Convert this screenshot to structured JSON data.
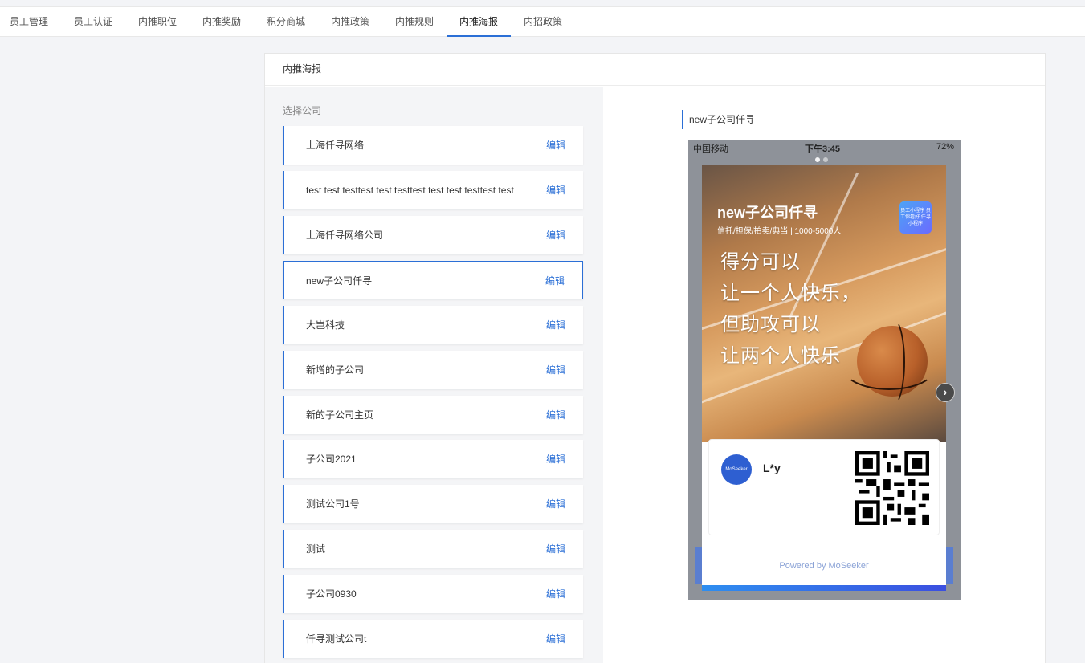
{
  "nav": {
    "tabs": [
      {
        "label": "员工管理"
      },
      {
        "label": "员工认证"
      },
      {
        "label": "内推职位"
      },
      {
        "label": "内推奖励"
      },
      {
        "label": "积分商城"
      },
      {
        "label": "内推政策"
      },
      {
        "label": "内推规则"
      },
      {
        "label": "内推海报"
      },
      {
        "label": "内招政策"
      }
    ],
    "active_index": 7
  },
  "panel": {
    "title": "内推海报",
    "select_caption": "选择公司",
    "edit_label": "编辑",
    "companies": [
      {
        "name": "上海仟寻网络"
      },
      {
        "name": "test test testtest test testtest test test testtest test"
      },
      {
        "name": "上海仟寻网络公司"
      },
      {
        "name": "new子公司仟寻"
      },
      {
        "name": "大岂科技"
      },
      {
        "name": "新增的子公司"
      },
      {
        "name": "新的子公司主页"
      },
      {
        "name": "子公司2021"
      },
      {
        "name": "测试公司1号"
      },
      {
        "name": "测试"
      },
      {
        "name": "子公司0930"
      },
      {
        "name": "仟寻测试公司t"
      }
    ],
    "selected_index": 3
  },
  "preview": {
    "title": "new子公司仟寻",
    "status": {
      "carrier": "中国移动",
      "time": "下午3:45",
      "battery": "72%"
    },
    "poster": {
      "company_name": "new子公司仟寻",
      "company_meta": "信托/担保/拍卖/典当  |  1000-5000人",
      "logo_text": "员工小程序 员工你看好 仟寻小程序",
      "slogan_lines": [
        "得分可以",
        "让一个人快乐，",
        "但助攻可以",
        "让两个人快乐"
      ],
      "user_name": "L*y",
      "avatar_text": "MoSeeker",
      "powered_by": "Powered by MoSeeker"
    }
  },
  "colors": {
    "accent": "#2b6fd6",
    "page_bg": "#f3f4f7"
  }
}
